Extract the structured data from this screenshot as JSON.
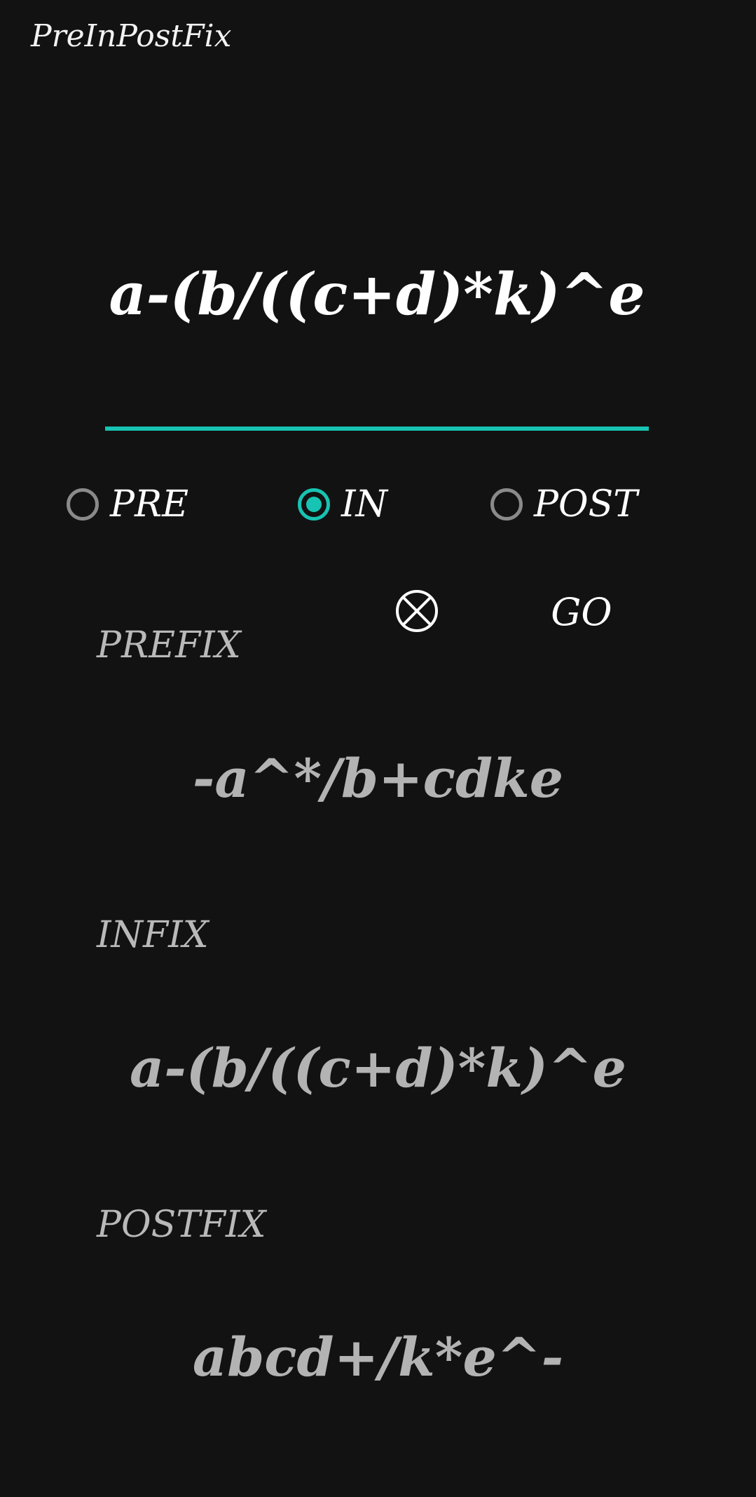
{
  "app": {
    "title": "PreInPostFix"
  },
  "input": {
    "value": "a-(b/((c+d)*k)^e"
  },
  "colors": {
    "accent": "#17c3b2",
    "background": "#121212",
    "label": "#b9b9b9",
    "result": "#b3b3b3"
  },
  "mode": {
    "selected": "IN",
    "options": [
      {
        "label": "PRE",
        "checked": false
      },
      {
        "label": "IN",
        "checked": true
      },
      {
        "label": "POST",
        "checked": false
      }
    ]
  },
  "actions": {
    "clear_icon": "circle-x-icon",
    "go_label": "GO"
  },
  "results": {
    "prefix": {
      "label": "PREFIX",
      "value": "-a^*/b+cdke"
    },
    "infix": {
      "label": "INFIX",
      "value": "a-(b/((c+d)*k)^e"
    },
    "postfix": {
      "label": "POSTFIX",
      "value": "abcd+/k*e^-"
    }
  }
}
